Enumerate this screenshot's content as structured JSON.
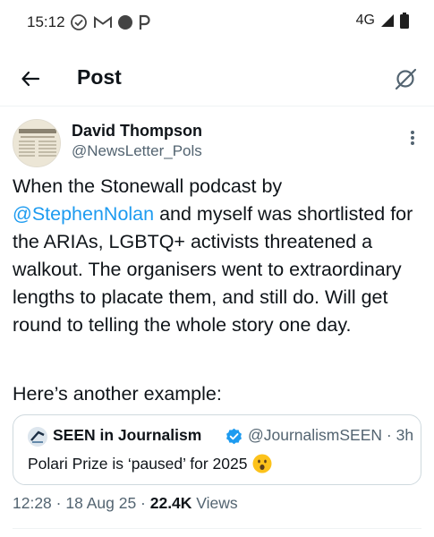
{
  "status_bar": {
    "time": "15:12",
    "app_icons": [
      "check-circle-icon",
      "gmail-icon",
      "record-dot-icon",
      "parking-icon"
    ],
    "network": "4G",
    "signal_icon": "signal-icon",
    "battery_icon": "battery-icon"
  },
  "header": {
    "title": "Post",
    "back_icon": "arrow-left-icon",
    "grok_icon": "grok-icon"
  },
  "author": {
    "name": "David Thompson",
    "handle": "@NewsLetter_Pols"
  },
  "tweet": {
    "text_before": "When the Stonewall podcast by ",
    "mention": "@StephenNolan",
    "text_after": " and myself was shortlisted for the ARIAs, LGBTQ+ activists threatened a walkout. The organisers went to extraordinary lengths to placate them, and still do. Will get round to telling the whole story one day.",
    "text_2": "Here’s another example:"
  },
  "quote": {
    "author_name": "SEEN in Journalism",
    "handle_time": "@JournalismSEEN · 3h",
    "text": "Polari Prize is ‘paused’ for 2025"
  },
  "meta": {
    "time_date": "12:28 · 18 Aug 25 · ",
    "views_count": "22.4K",
    "views_label": " Views"
  },
  "colors": {
    "accent": "#1d9bf0",
    "text_primary": "#0f1419",
    "text_secondary": "#536471",
    "border": "#cfd9de"
  }
}
